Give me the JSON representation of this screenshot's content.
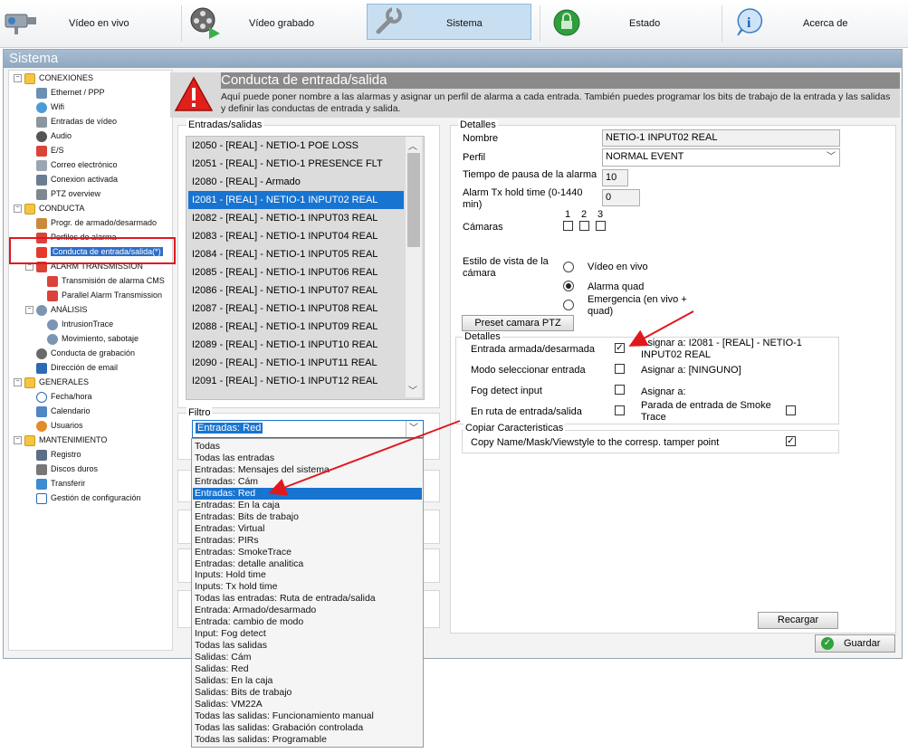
{
  "nav": {
    "items": [
      {
        "label": "Vídeo en vivo",
        "icon": "camera-icon"
      },
      {
        "label": "Vídeo grabado",
        "icon": "film-reel-icon"
      },
      {
        "label": "Sistema",
        "icon": "wrench-icon"
      },
      {
        "label": "Estado",
        "icon": "status-lock-icon"
      },
      {
        "label": "Acerca de",
        "icon": "info-icon"
      }
    ],
    "active": "Sistema"
  },
  "window_title": "Sistema",
  "tree": {
    "conexiones": "CONEXIONES",
    "ethernet": "Ethernet / PPP",
    "wifi": "Wifi",
    "entradas_video": "Entradas de vídeo",
    "audio": "Audio",
    "es": "E/S",
    "correo": "Correo electrónico",
    "conexion_activada": "Conexion activada",
    "ptz_overview": "PTZ overview",
    "conducta": "CONDUCTA",
    "progr": "Progr. de armado/desarmado",
    "perfiles": "Perfiles de alarma",
    "conducta_es": "Conducta de entrada/salida(*)",
    "alarm_transmission": "ALARM TRANSMISSION",
    "transmision_cms": "Transmisión de alarma CMS",
    "parallel": "Parallel Alarm Transmission",
    "analisis": "ANÁLISIS",
    "intrusiontrace": "IntrusionTrace",
    "movimiento": "Movimiento, sabotaje",
    "conducta_grabacion": "Conducta de grabación",
    "direccion_email": "Dirección de email",
    "generales": "GENERALES",
    "fecha": "Fecha/hora",
    "calendario": "Calendario",
    "usuarios": "Usuarios",
    "mantenimiento": "MANTENIMIENTO",
    "registro": "Registro",
    "discos": "Discos duros",
    "transferir": "Transferir",
    "gestion": "Gestión de configuración"
  },
  "header": {
    "title": "Conducta de entrada/salida",
    "description": "Aquí puede poner nombre a las alarmas y asignar un perfil de alarma a cada entrada. También puedes programar los bits de trabajo de la entrada y las salidas y definir las conductas de entrada y salida."
  },
  "io_list": {
    "title": "Entradas/salidas",
    "items": [
      "I2050 - [REAL] - NETIO-1 POE LOSS",
      "I2051 - [REAL] - NETIO-1 PRESENCE FLT",
      "I2080 - [REAL] - Armado",
      "I2081 - [REAL] - NETIO-1 INPUT02 REAL",
      "I2082 - [REAL] - NETIO-1 INPUT03 REAL",
      "I2083 - [REAL] - NETIO-1 INPUT04 REAL",
      "I2084 - [REAL] - NETIO-1 INPUT05 REAL",
      "I2085 - [REAL] - NETIO-1 INPUT06 REAL",
      "I2086 - [REAL] - NETIO-1 INPUT07 REAL",
      "I2087 - [REAL] - NETIO-1 INPUT08 REAL",
      "I2088 - [REAL] - NETIO-1 INPUT09 REAL",
      "I2089 - [REAL] - NETIO-1 INPUT10 REAL",
      "I2090 - [REAL] - NETIO-1 INPUT11 REAL",
      "I2091 - [REAL] - NETIO-1 INPUT12 REAL"
    ],
    "selected_index": 3
  },
  "filter": {
    "title": "Filtro",
    "value": "Entradas: Red",
    "options": [
      "Todas",
      "Todas las entradas",
      "Entradas: Mensajes del sistema",
      "Entradas: Cám",
      "Entradas: Red",
      "Entradas: En la caja",
      "Entradas: Bits de trabajo",
      "Entradas: Virtual",
      "Entradas: PIRs",
      "Entradas: SmokeTrace",
      "Entradas: detalle analitica",
      "Inputs: Hold time",
      "Inputs: Tx hold time",
      "Todas las entradas: Ruta de entrada/salida",
      "Entrada: Armado/desarmado",
      "Entrada: cambio de modo",
      "Input: Fog detect",
      "Todas las salidas",
      "Salidas: Cám",
      "Salidas: Red",
      "Salidas: En la caja",
      "Salidas: Bits de trabajo",
      "Salidas: VM22A",
      "Todas las salidas: Funcionamiento manual",
      "Todas las salidas: Grabación controlada",
      "Todas las salidas: Programable"
    ],
    "selected_index": 4
  },
  "details": {
    "title": "Detalles",
    "nombre_label": "Nombre",
    "nombre_value": "NETIO-1 INPUT02 REAL",
    "perfil_label": "Perfil",
    "perfil_value": "NORMAL EVENT",
    "pausa_label": "Tiempo de pausa de la alarma (",
    "pausa_value": "10",
    "hold_label": "Alarm Tx hold time (0-1440 min)",
    "hold_value": "0",
    "camaras_label": "Cámaras",
    "cam1": "1",
    "cam2": "2",
    "cam3": "3",
    "estilo_label": "Estilo de vista de la cámara",
    "radio_vivo": "Vídeo en vivo",
    "radio_quad": "Alarma quad",
    "radio_emerg": "Emergencia (en vivo + quad)",
    "radio_selected": "Alarma quad",
    "preset_button": "Preset camara PTZ"
  },
  "details2": {
    "title": "Detalles",
    "rows": [
      {
        "label": "Entrada armada/desarmada",
        "checked": true,
        "assign": "Asignar a: I2081 - [REAL] - NETIO-1 INPUT02 REAL"
      },
      {
        "label": "Modo seleccionar entrada",
        "checked": false,
        "assign": "Asignar a: [NINGUNO]"
      },
      {
        "label": "Fog detect input",
        "checked": false,
        "assign": "Asignar a:"
      },
      {
        "label": "En ruta de entrada/salida",
        "checked": false,
        "assign": "Parada de entrada de Smoke Trace"
      }
    ]
  },
  "copy": {
    "title": "Copiar Caracteristicas",
    "label": "Copy Name/Mask/Viewstyle to the corresp. tamper point",
    "checked": true
  },
  "buttons": {
    "recargar": "Recargar",
    "guardar": "Guardar"
  },
  "colors": {
    "selection": "#1874d1",
    "annotation_red": "#e0181e",
    "title_bar": "#8ea7c0"
  }
}
